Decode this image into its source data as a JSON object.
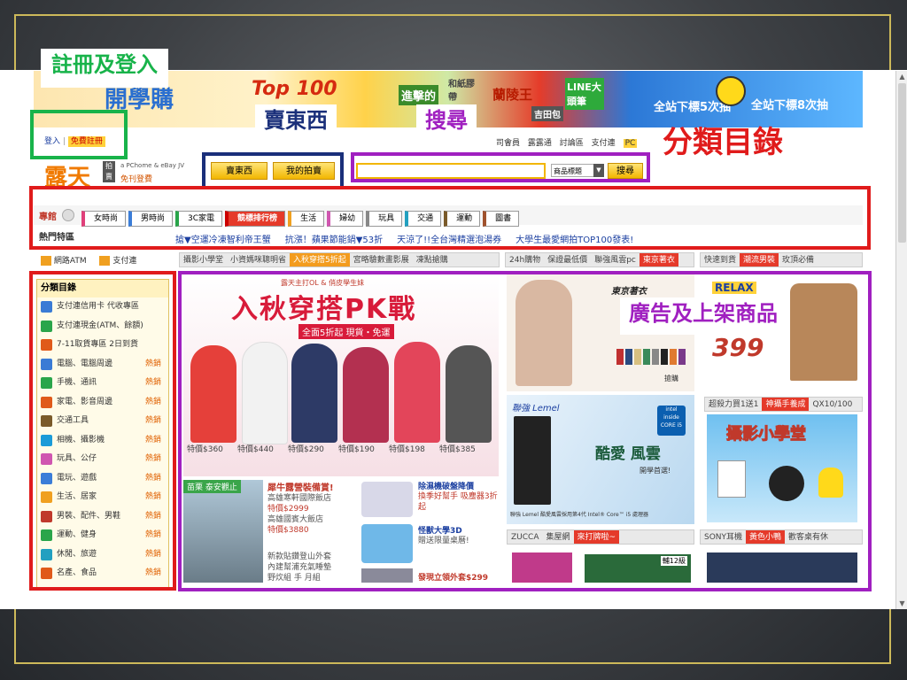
{
  "overlay_labels": {
    "register_login": "註冊及登入",
    "sell": "賣東西",
    "search": "搜尋",
    "categories": "分類目錄",
    "ads_products": "廣告及上架商品"
  },
  "banner": {
    "texts": [
      "開學購",
      "Top 100",
      "進擊的",
      "和紙膠帶",
      "蘭陵王",
      "LINE大頭筆",
      "吉田包",
      "全站下標5次抽",
      "全站下標8次抽"
    ]
  },
  "header": {
    "login": "登入",
    "free_register": "免費註冊",
    "logo": "露天",
    "logo_sub": "拍賣",
    "pchome_note": "a PChome & eBay JV",
    "free_listing": "免刊登費",
    "top_links": [
      "司會員",
      "露露通",
      "討論區",
      "支付連",
      "PC"
    ],
    "sell_button": "賣東西",
    "my_auction_button": "我的拍賣",
    "search_placeholder": "",
    "search_scope": "商品標題",
    "search_button": "搜尋"
  },
  "category_bar": {
    "label": "專館",
    "tabs": [
      "女時尚",
      "男時尚",
      "3C家電",
      "競標排行榜",
      "生活",
      "婦幼",
      "玩具",
      "交通",
      "運動",
      "圖書"
    ]
  },
  "hot_zone": {
    "label": "熱門特區",
    "links": [
      "搶▼空運冷凍智利帝王蟹",
      "抗漲！蘋果節能鍋▼53折",
      "天涼了!!全台灣精選泡湯券",
      "大學生最愛網拍TOP100發表!"
    ]
  },
  "side_top": {
    "atm": "網路ATM",
    "paylink": "支付連"
  },
  "sidebar": {
    "title": "分類目錄",
    "promos": [
      "支付連信用卡 代收專區",
      "支付連現金(ATM、餘額)",
      "7-11取貨專區 2日到貨"
    ],
    "items": [
      {
        "label": "電腦、電腦周邊",
        "hot": "熱銷"
      },
      {
        "label": "手機、通訊",
        "hot": "熱銷"
      },
      {
        "label": "家電、影音周邊",
        "hot": "熱銷"
      },
      {
        "label": "交通工具",
        "hot": "熱銷"
      },
      {
        "label": "相機、攝影機",
        "hot": "熱銷"
      },
      {
        "label": "玩具、公仔",
        "hot": "熱銷"
      },
      {
        "label": "電玩、遊戲",
        "hot": "熱銷"
      },
      {
        "label": "生活、居家",
        "hot": "熱銷"
      },
      {
        "label": "男裝、配件、男鞋",
        "hot": "熱銷"
      },
      {
        "label": "運動、健身",
        "hot": "熱銷"
      },
      {
        "label": "休閒、旅遊",
        "hot": "熱銷"
      },
      {
        "label": "名產、食品",
        "hot": "熱銷"
      }
    ]
  },
  "main_tabs": [
    "攝影小學堂",
    "小資媽咪聰明省",
    "入秋穿搭5折起",
    "宮略驗數畫影展",
    "凍點搶購"
  ],
  "right_tabs_1": [
    "24h購物",
    "保證最低價",
    "聯強風雲pc",
    "東京著衣"
  ],
  "right_tabs_2": [
    "快速到貨",
    "潮流男裝",
    "玫頂必備"
  ],
  "hero": {
    "small_top": "露天主打OL & 俏皮學生妹",
    "title": "入秋穿搭PK戰",
    "sub": "全面5折起 現貨・免運",
    "prices": [
      "特價$360",
      "特價$440",
      "特價$290",
      "特價$190",
      "特價$198",
      "特價$385"
    ]
  },
  "promo_block": {
    "hotel_tag": "苗栗 泰安觀止",
    "hotel_title": "犀牛露營裝備賞!",
    "hotel_lines": [
      "高雄寒軒國際飯店",
      "特價$2999",
      "高雄國賓大飯店",
      "特價$3880"
    ],
    "list_lines": [
      "新款貼鑽登山外套",
      "內建幫浦充氣睡墊",
      "野炊組 手 月組"
    ],
    "p1_title": "除濕機破盤降價",
    "p1_sub": "換季好幫手 吸塵器3折起",
    "p2_title": "怪獸大學3D",
    "p2_sub": "贈送限量桌曆!",
    "p3_title": "發現立領外套$299"
  },
  "right_panel": {
    "brand1": "東京著衣",
    "relax": "RELAX",
    "price": "399",
    "ad_text": "搶購",
    "lemel_brand": "聯強 Lemel",
    "lemel_slogan": "酷愛 風雲",
    "lemel_sub": "開學首選!",
    "intel": "intel inside CORE i5",
    "lemel_caption": "聯強 Lemel 酷愛風雲採用第4代 Intel® Core™ i5 處理器",
    "tabs3": [
      "超殺力買1送1",
      "神攝手養成",
      "QX10/100"
    ],
    "camera_title": "攝影小學堂",
    "tabs4": [
      "ZUCCA",
      "集屋網",
      "來打牌啦~"
    ],
    "tabs5": [
      "SONY耳機",
      "黃色小鴨",
      "歡客桌有休"
    ],
    "cards_tag": "輔12級"
  },
  "colors": {
    "green": "#18b34a",
    "navy": "#1a2f7a",
    "purple": "#a020c0",
    "red": "#e01b1b",
    "gold": "#cdb95a"
  }
}
